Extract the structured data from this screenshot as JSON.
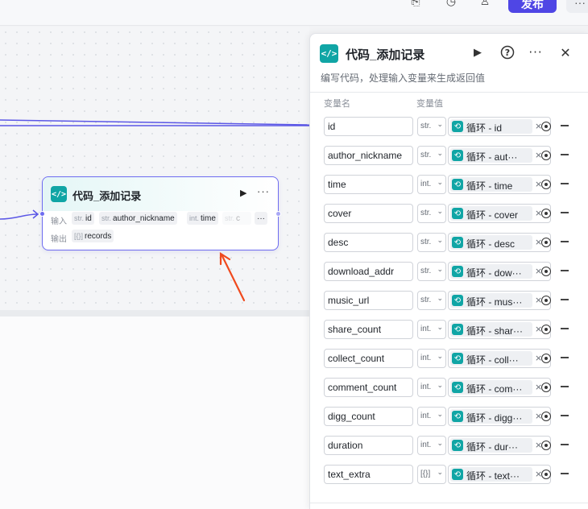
{
  "toolbar": {
    "publish_label": "发布",
    "more_glyph": "···"
  },
  "node": {
    "badge": "</>",
    "title": "代码_添加记录",
    "input_label": "输入",
    "output_label": "输出",
    "inputs": [
      {
        "type": "str.",
        "name": "id"
      },
      {
        "type": "str.",
        "name": "author_nickname"
      },
      {
        "type": "int.",
        "name": "time"
      },
      {
        "type": "str.",
        "name": "c"
      }
    ],
    "output": {
      "type": "[{}]",
      "name": "records"
    },
    "more_glyph": "···"
  },
  "panel": {
    "badge": "</>",
    "title": "代码_添加记录",
    "description": "编写代码，处理输入变量来生成返回值",
    "col_name": "变量名",
    "col_value": "变量值",
    "rows": [
      {
        "name": "id",
        "type": "str.",
        "value": "循环 - id"
      },
      {
        "name": "author_nickname",
        "type": "str.",
        "value": "循环 - aut···"
      },
      {
        "name": "time",
        "type": "int.",
        "value": "循环 - time"
      },
      {
        "name": "cover",
        "type": "str.",
        "value": "循环 - cover"
      },
      {
        "name": "desc",
        "type": "str.",
        "value": "循环 - desc"
      },
      {
        "name": "download_addr",
        "type": "str.",
        "value": "循环 - dow···"
      },
      {
        "name": "music_url",
        "type": "str.",
        "value": "循环 - mus···"
      },
      {
        "name": "share_count",
        "type": "int.",
        "value": "循环 - shar···"
      },
      {
        "name": "collect_count",
        "type": "int.",
        "value": "循环 - coll···"
      },
      {
        "name": "comment_count",
        "type": "int.",
        "value": "循环 - com···"
      },
      {
        "name": "digg_count",
        "type": "int.",
        "value": "循环 - digg···"
      },
      {
        "name": "duration",
        "type": "int.",
        "value": "循环 - dur···"
      },
      {
        "name": "text_extra",
        "type": "[{}]",
        "value": "循环 - text···"
      }
    ]
  },
  "colors": {
    "accent": "#4f46e5",
    "code_badge": "#10a5a5",
    "node_border": "#6e6cf0",
    "annotation_arrow": "#f04a1e"
  }
}
